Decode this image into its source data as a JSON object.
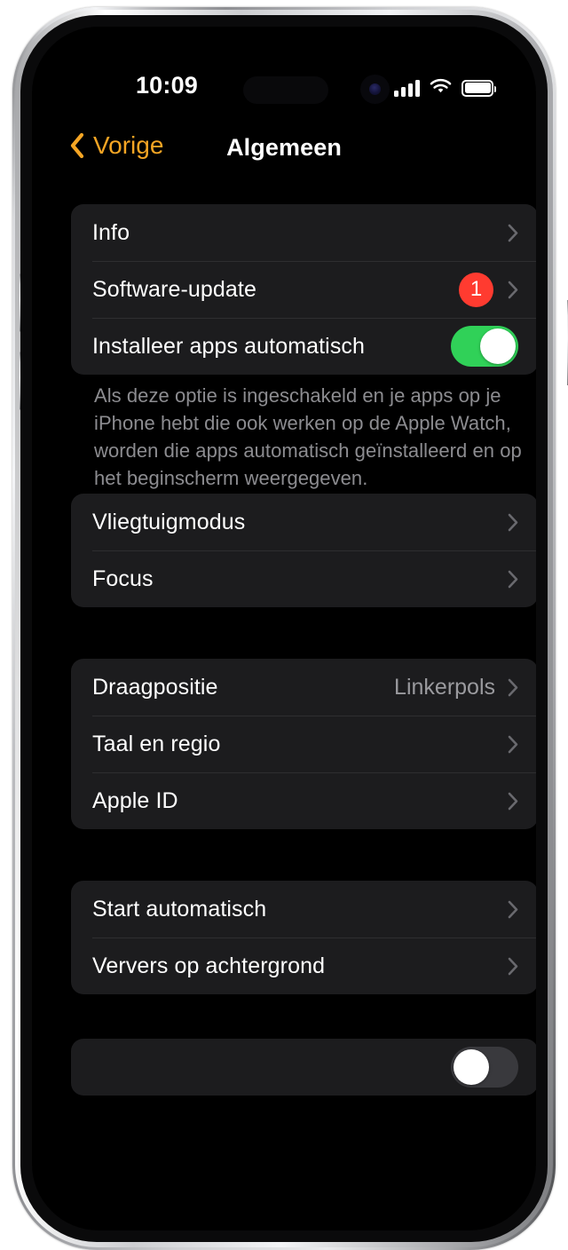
{
  "status_bar": {
    "time": "10:09",
    "cellular_icon": "cellular-signal-icon",
    "cellular_bars": 4,
    "wifi_icon": "wifi-icon",
    "battery_icon": "battery-icon",
    "battery_level_percent": 100
  },
  "nav": {
    "back_label": "Vorige",
    "back_icon": "chevron-left-icon",
    "title": "Algemeen"
  },
  "colors": {
    "accent": "#F5A524",
    "toggle_on": "#30D158",
    "toggle_off": "#39393D",
    "badge": "#FF3B30",
    "card_background": "#1C1C1E",
    "screen_background": "#000000",
    "separator": "#2E2E30",
    "secondary_text": "#9A9A9E",
    "footnote_text": "#8C8C90"
  },
  "groups": [
    {
      "id": "group-1",
      "rows": [
        {
          "label": "Info",
          "accessory": "chevron",
          "value": ""
        },
        {
          "label": "Software-update",
          "accessory": "badge-chevron",
          "badge": "1",
          "value": ""
        },
        {
          "label": "Installeer apps automatisch",
          "accessory": "toggle",
          "toggle_state": "on"
        }
      ]
    },
    {
      "id": "group-2",
      "rows": [
        {
          "label": "Vliegtuigmodus",
          "accessory": "chevron",
          "value": ""
        },
        {
          "label": "Focus",
          "accessory": "chevron",
          "value": ""
        }
      ]
    },
    {
      "id": "group-3",
      "rows": [
        {
          "label": "Draagpositie",
          "accessory": "chevron",
          "value": "Linkerpols"
        },
        {
          "label": "Taal en regio",
          "accessory": "chevron",
          "value": ""
        },
        {
          "label": "Apple ID",
          "accessory": "chevron",
          "value": ""
        }
      ]
    },
    {
      "id": "group-4",
      "rows": [
        {
          "label": "Start automatisch",
          "accessory": "chevron",
          "value": ""
        },
        {
          "label": "Ververs op achtergrond",
          "accessory": "chevron",
          "value": ""
        }
      ]
    },
    {
      "id": "group-5",
      "rows": [
        {
          "label": "",
          "accessory": "toggle",
          "toggle_state": "off"
        }
      ]
    }
  ],
  "footnotes": [
    {
      "id": "footnote-1",
      "text": "Als deze optie is ingeschakeld en je apps op je iPhone hebt die ook werken op de Apple Watch, worden die apps automatisch geïnstalleerd en op het beginscherm weergegeven."
    }
  ]
}
